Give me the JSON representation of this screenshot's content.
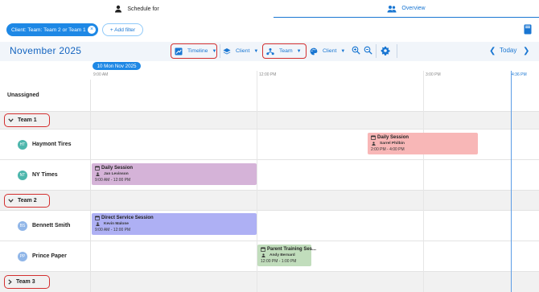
{
  "tabs": {
    "schedule_label": "Schedule for",
    "overview_label": "Overview"
  },
  "filters": {
    "chip_label": "Client: Team: Team 2 or Team 1",
    "add_filter_label": "+ Add filter"
  },
  "toolbar": {
    "month": "November 2025",
    "timeline_label": "Timeline",
    "client_label": "Client",
    "team_label": "Team",
    "client2_label": "Client",
    "today_label": "Today"
  },
  "timeline": {
    "date_label": "10 Mon Nov 2025",
    "times": [
      "9:00 AM",
      "12:00 PM",
      "3:00 PM",
      "4:36 PM"
    ]
  },
  "rows": {
    "unassigned": "Unassigned",
    "team1": "Team 1",
    "team2": "Team 2",
    "team3": "Team 3",
    "clients": [
      {
        "initials": "HT",
        "name": "Haymont Tires"
      },
      {
        "initials": "NT",
        "name": "NY Times"
      },
      {
        "initials": "BS",
        "name": "Bennett Smith"
      },
      {
        "initials": "PP",
        "name": "Prince Paper"
      }
    ]
  },
  "events": [
    {
      "title": "Daily Session",
      "person": "Sarrel Philbin",
      "time": "2:00 PM - 4:00 PM",
      "color": "#f8b7b7"
    },
    {
      "title": "Daily Session",
      "person": "Jan Levinson",
      "time": "9:00 AM - 12:00 PM",
      "color": "#d5b3d8"
    },
    {
      "title": "Direct Service Session",
      "person": "Kevin Malone",
      "time": "9:00 AM - 12:00 PM",
      "color": "#aeb0f4"
    },
    {
      "title": "Parent Training Ses...",
      "person": "Andy Bernard",
      "time": "12:00 PM - 1:00 PM",
      "color": "#c1ddbc"
    }
  ],
  "icons": [
    "person-icon",
    "people-icon",
    "close-icon",
    "book-icon",
    "timeline-icon",
    "layers-icon",
    "team-icon",
    "palette-icon",
    "zoom-in-icon",
    "zoom-out-icon",
    "gear-icon",
    "chevron-left-icon",
    "chevron-right-icon",
    "calendar-icon"
  ],
  "colors": {
    "accent": "#1976d2",
    "highlight_outline": "#d32f2f"
  }
}
